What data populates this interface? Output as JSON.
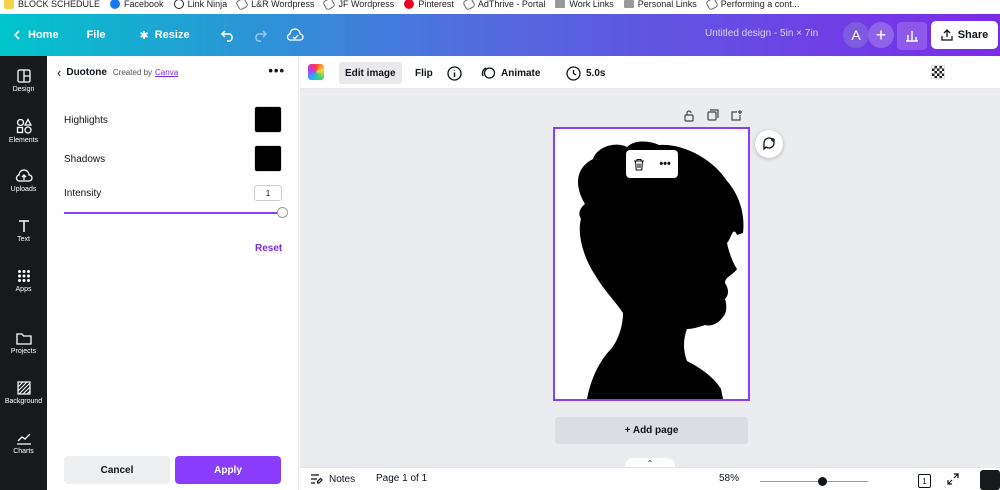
{
  "bookmarks": [
    {
      "label": "BLOCK SCHEDULE",
      "icon": "note-icon"
    },
    {
      "label": "Facebook",
      "icon": "facebook-icon"
    },
    {
      "label": "Link Ninja",
      "icon": "globe-icon"
    },
    {
      "label": "L&R Wordpress",
      "icon": "link-icon"
    },
    {
      "label": "JF Wordpress",
      "icon": "link-icon"
    },
    {
      "label": "Pinterest",
      "icon": "pinterest-icon"
    },
    {
      "label": "AdThrive - Portal",
      "icon": "link-icon"
    },
    {
      "label": "Work Links",
      "icon": "folder-icon"
    },
    {
      "label": "Personal Links",
      "icon": "folder-icon"
    },
    {
      "label": "Performing a cont...",
      "icon": "link-icon"
    }
  ],
  "topbar": {
    "home": "Home",
    "file": "File",
    "resize": "Resize",
    "doc_title": "Untitled design - 5in × 7in",
    "avatar_initial": "A",
    "plus": "+",
    "share": "Share"
  },
  "rail": [
    {
      "label": "Design",
      "icon": "design-icon"
    },
    {
      "label": "Elements",
      "icon": "elements-icon"
    },
    {
      "label": "Uploads",
      "icon": "upload-cloud-icon"
    },
    {
      "label": "Text",
      "icon": "text-icon"
    },
    {
      "label": "Apps",
      "icon": "apps-grid-icon"
    },
    {
      "label": "Projects",
      "icon": "folder-icon"
    },
    {
      "label": "Background",
      "icon": "background-hatch-icon"
    },
    {
      "label": "Charts",
      "icon": "chart-line-icon"
    }
  ],
  "panel": {
    "title": "Duotone",
    "created_by": "Created by",
    "creator": "Canva",
    "highlights_label": "Highlights",
    "highlights_color": "#000000",
    "shadows_label": "Shadows",
    "shadows_color": "#000000",
    "intensity_label": "Intensity",
    "intensity_value": "1",
    "intensity_fraction": 1.0,
    "reset": "Reset",
    "cancel": "Cancel",
    "apply": "Apply"
  },
  "toolbar": {
    "edit_image": "Edit image",
    "flip": "Flip",
    "animate": "Animate",
    "duration": "5.0s"
  },
  "canvas": {
    "add_page": "+ Add page"
  },
  "bottom": {
    "notes": "Notes",
    "page_info": "Page 1 of 1",
    "zoom": "58%",
    "page_count": "1"
  },
  "colors": {
    "accent": "#8b3dff",
    "rail_bg": "#18191b",
    "canvas_bg": "#ebecf0"
  }
}
